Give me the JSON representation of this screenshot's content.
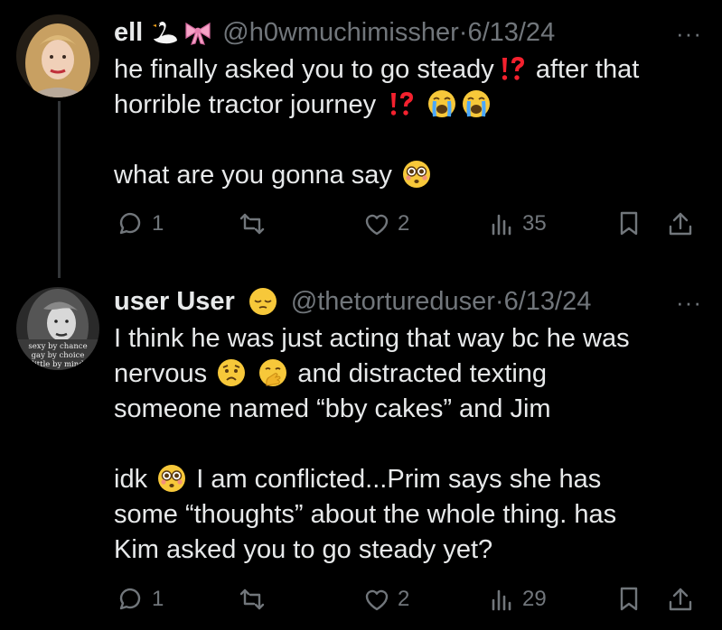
{
  "tweets": [
    {
      "name": "ell",
      "handle": "@h0wmuchimissher",
      "sep": "·",
      "date": "6/13/24",
      "more": "···",
      "line1a": "he finally asked you to go steady",
      "line1b": "after that",
      "line2": "horrible tractor journey",
      "line3": "what are you gonna say",
      "replies": "1",
      "likes": "2",
      "views": "35"
    },
    {
      "name": "user User",
      "handle": "@thetortureduser",
      "sep": "·",
      "date": "6/13/24",
      "more": "···",
      "line1": "I think he was just acting that way bc he was",
      "line2a": "nervous",
      "line2b": "and distracted texting",
      "line3": "someone named “bby cakes” and Jim",
      "line4a": "idk",
      "line4b": "I am conflicted...Prim says she has",
      "line5": "some “thoughts” about the whole thing. has",
      "line6": "Kim asked you to go steady yet?",
      "replies": "1",
      "likes": "2",
      "views": "29",
      "avatar_text": [
        "sexy by chance",
        "gay by choice",
        "little by mind"
      ]
    }
  ],
  "colors": {
    "background": "#000000",
    "text": "#e7e9ea",
    "muted": "#71767b",
    "thread": "#333639",
    "alarm": "#f4212e"
  },
  "icons": [
    "swan-icon",
    "ribbon-icon",
    "exclamation-question-icon",
    "crying-face-icon",
    "flushed-face-icon",
    "pensive-face-icon",
    "worried-face-icon",
    "hand-over-mouth-icon",
    "reply-icon",
    "retweet-icon",
    "like-icon",
    "views-icon",
    "bookmark-icon",
    "share-icon",
    "more-icon"
  ]
}
